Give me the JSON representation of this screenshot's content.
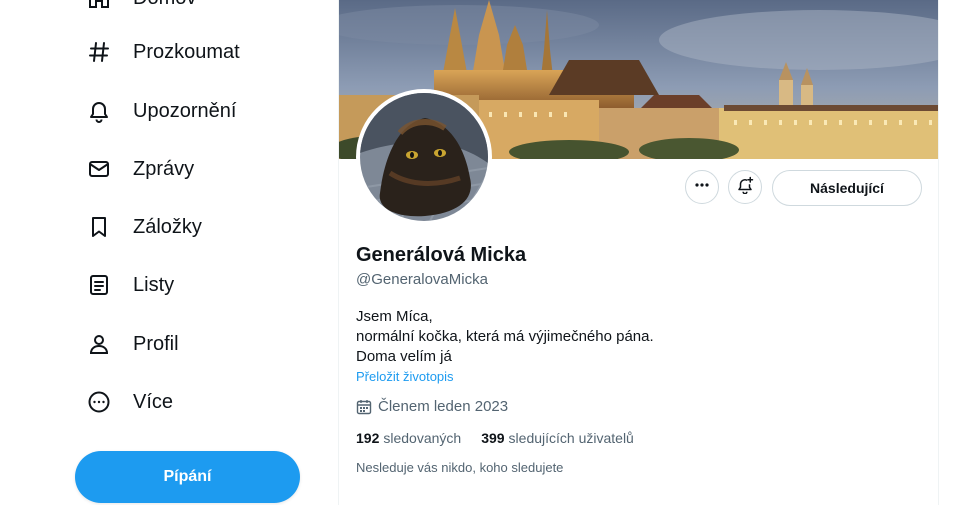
{
  "sidebar": {
    "items": [
      {
        "label": "Domov",
        "icon": "home-icon"
      },
      {
        "label": "Prozkoumat",
        "icon": "hashtag-icon"
      },
      {
        "label": "Upozornění",
        "icon": "bell-icon"
      },
      {
        "label": "Zprávy",
        "icon": "envelope-icon"
      },
      {
        "label": "Záložky",
        "icon": "bookmark-icon"
      },
      {
        "label": "Listy",
        "icon": "list-icon"
      },
      {
        "label": "Profil",
        "icon": "person-icon"
      },
      {
        "label": "Více",
        "icon": "more-circle-icon"
      }
    ],
    "post_button": "Pípání"
  },
  "profile": {
    "display_name": "Generálová Micka",
    "handle": "@GeneralovaMicka",
    "bio_lines": [
      "Jsem Míca,",
      "normální kočka, která má výjimečného pána.",
      "Doma velím já"
    ],
    "translate_bio": "Přeložit životopis",
    "joined": "Členem leden 2023",
    "following_count": "192",
    "following_label": "sledovaných",
    "followers_count": "399",
    "followers_label": "sledujících uživatelů",
    "followed_by_note": "Nesleduje vás nikdo, koho sledujete",
    "follow_button": "Následující"
  },
  "colors": {
    "accent": "#1d9bf0",
    "text_primary": "#0f1419",
    "text_secondary": "#536471",
    "border": "#cfd9de"
  }
}
